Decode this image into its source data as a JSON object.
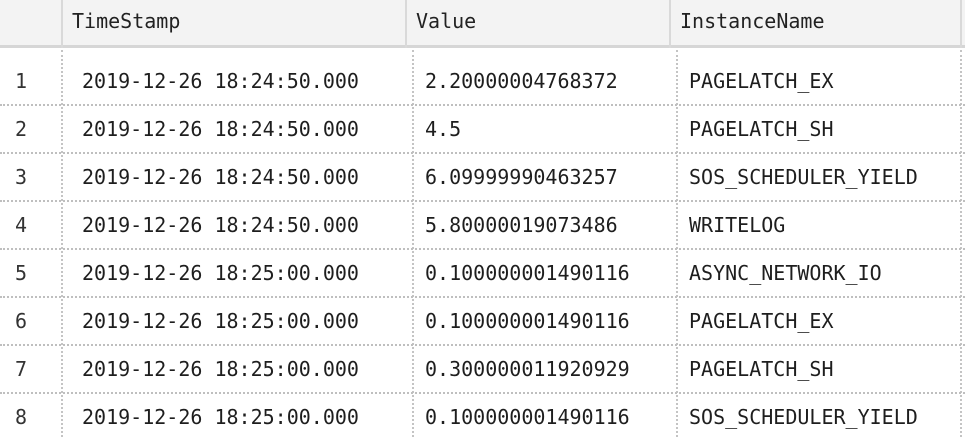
{
  "columns": {
    "rownum": "",
    "timestamp": "TimeStamp",
    "value": "Value",
    "instance": "InstanceName"
  },
  "rows": [
    {
      "n": "1",
      "timestamp": "2019-12-26 18:24:50.000",
      "value": "2.20000004768372",
      "instance": "PAGELATCH_EX"
    },
    {
      "n": "2",
      "timestamp": "2019-12-26 18:24:50.000",
      "value": "4.5",
      "instance": "PAGELATCH_SH"
    },
    {
      "n": "3",
      "timestamp": "2019-12-26 18:24:50.000",
      "value": "6.09999990463257",
      "instance": "SOS_SCHEDULER_YIELD"
    },
    {
      "n": "4",
      "timestamp": "2019-12-26 18:24:50.000",
      "value": "5.80000019073486",
      "instance": "WRITELOG"
    },
    {
      "n": "5",
      "timestamp": "2019-12-26 18:25:00.000",
      "value": "0.100000001490116",
      "instance": "ASYNC_NETWORK_IO"
    },
    {
      "n": "6",
      "timestamp": "2019-12-26 18:25:00.000",
      "value": "0.100000001490116",
      "instance": "PAGELATCH_EX"
    },
    {
      "n": "7",
      "timestamp": "2019-12-26 18:25:00.000",
      "value": "0.300000011920929",
      "instance": "PAGELATCH_SH"
    },
    {
      "n": "8",
      "timestamp": "2019-12-26 18:25:00.000",
      "value": "0.100000001490116",
      "instance": "SOS_SCHEDULER_YIELD"
    }
  ]
}
